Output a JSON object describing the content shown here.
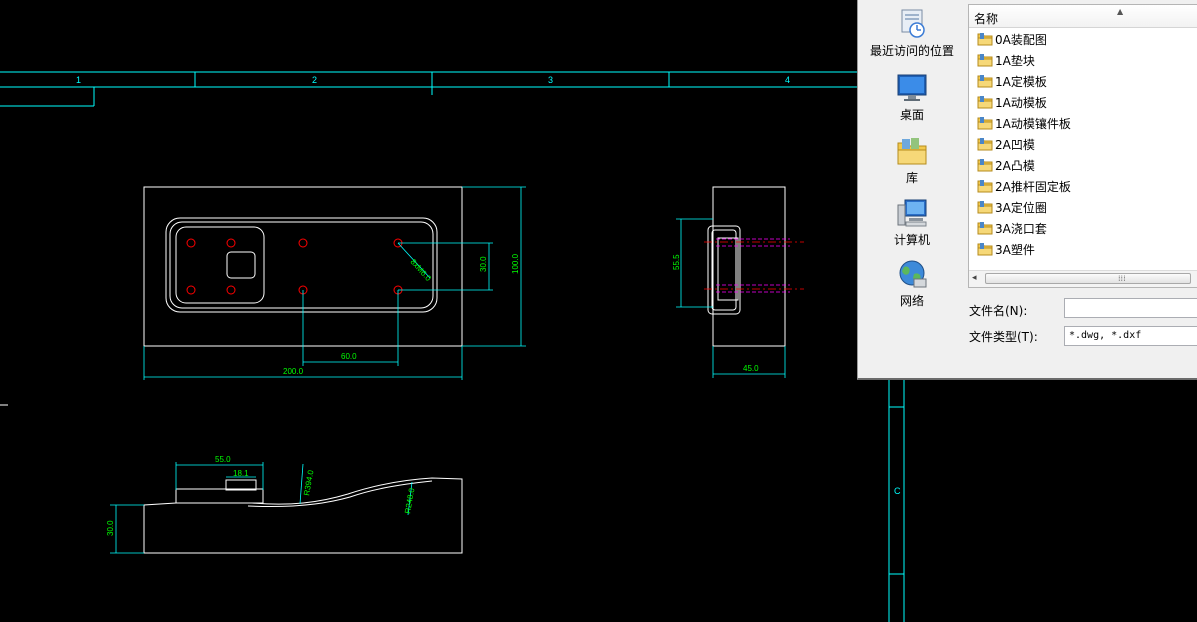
{
  "drawing": {
    "zones": [
      "1",
      "2",
      "3",
      "4"
    ],
    "side_zone": "C",
    "dimensions": {
      "top_width": "200.0",
      "hole_spacing": "60.0",
      "top_height": "100.0",
      "hole_vertical": "30.0",
      "diag": "8xM6.0",
      "side_height": "55.5",
      "side_width": "45.0",
      "sect_len": "55.0",
      "sect_pocket": "18.1",
      "sect_r1": "R394.0",
      "sect_r2": "R248.0",
      "sect_height": "30.0"
    }
  },
  "dialog": {
    "places": [
      {
        "label": "最近访问的位置",
        "icon": "recent-places-icon"
      },
      {
        "label": "桌面",
        "icon": "desktop-icon"
      },
      {
        "label": "库",
        "icon": "library-icon"
      },
      {
        "label": "计算机",
        "icon": "computer-icon"
      },
      {
        "label": "网络",
        "icon": "network-icon"
      }
    ],
    "column_name": "名称",
    "files": [
      "0A装配图",
      "1A垫块",
      "1A定模板",
      "1A动模板",
      "1A动模镶件板",
      "2A凹模",
      "2A凸模",
      "2A推杆固定板",
      "3A定位圈",
      "3A浇口套",
      "3A塑件"
    ],
    "filename_label": "文件名(N):",
    "filename_value": "",
    "filetype_label": "文件类型(T):",
    "filetype_value": "*.dwg, *.dxf",
    "colors": {
      "cad_line": "#ffffff",
      "cad_dim": "#00ffff",
      "cad_text": "#00ff00",
      "hole": "#ff0000",
      "hidden": "#ff00ff",
      "folder": "#f2c94c"
    }
  }
}
